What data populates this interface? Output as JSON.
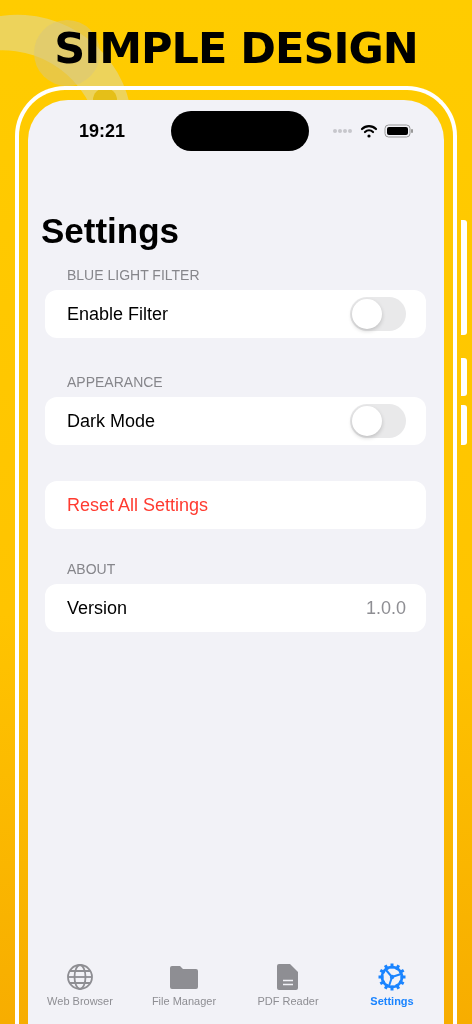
{
  "headline": "SIMPLE DESIGN",
  "status_bar": {
    "time": "19:21"
  },
  "title": "Settings",
  "sections": [
    {
      "header": "BLUE LIGHT FILTER",
      "rows": [
        {
          "kind": "toggle",
          "label": "Enable Filter",
          "on": false
        }
      ]
    },
    {
      "header": "APPEARANCE",
      "rows": [
        {
          "kind": "toggle",
          "label": "Dark Mode",
          "on": false
        }
      ]
    },
    {
      "rows": [
        {
          "kind": "action",
          "label": "Reset All Settings"
        }
      ]
    },
    {
      "header": "ABOUT",
      "rows": [
        {
          "kind": "value",
          "label": "Version",
          "value": "1.0.0"
        }
      ]
    }
  ],
  "tab_bar": [
    {
      "kind": "globe",
      "label": "Web Browser",
      "selected": false
    },
    {
      "kind": "folder",
      "label": "File Manager",
      "selected": false
    },
    {
      "kind": "document",
      "label": "PDF Reader",
      "selected": false
    },
    {
      "kind": "gear",
      "label": "Settings",
      "selected": true
    }
  ]
}
